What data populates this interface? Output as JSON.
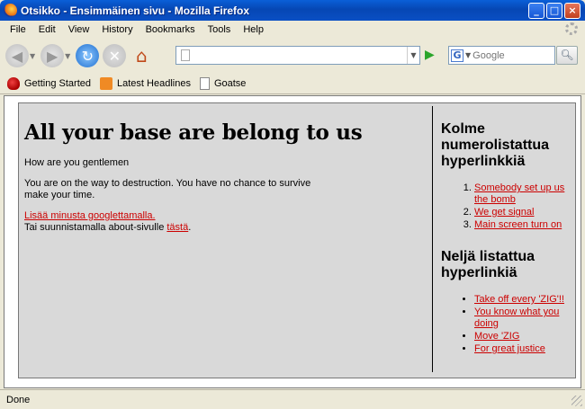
{
  "window": {
    "title": "Otsikko - Ensimmäinen sivu - Mozilla Firefox",
    "minimize_label": "_",
    "maximize_label": "□",
    "close_label": "×"
  },
  "menubar": {
    "items": [
      {
        "label": "File"
      },
      {
        "label": "Edit"
      },
      {
        "label": "View"
      },
      {
        "label": "History"
      },
      {
        "label": "Bookmarks"
      },
      {
        "label": "Tools"
      },
      {
        "label": "Help"
      }
    ]
  },
  "navbar": {
    "url_value": "",
    "search_placeholder": "Google",
    "search_engine_letter": "G"
  },
  "bookmarks": {
    "items": [
      {
        "label": "Getting Started"
      },
      {
        "label": "Latest Headlines"
      },
      {
        "label": "Goatse"
      }
    ]
  },
  "page": {
    "heading": "All your base are belong to us",
    "para1": "How are you gentlemen",
    "para2": "You are on the way to destruction. You have no chance to survive make your time.",
    "link1": "Lisää minusta googlettamalla.",
    "para3_prefix": "Tai suunnistamalla about-sivulle ",
    "link2": "tästä",
    "para3_suffix": ".",
    "side": {
      "heading1": "Kolme numerolistattua hyperlinkkiä",
      "ordered": [
        "Somebody set up us the bomb",
        "We get signal",
        "Main screen turn on"
      ],
      "heading2": "Neljä listattua hyperlinkiä",
      "unordered": [
        "Take off every 'ZIG'!!",
        "You know what you doing",
        "Move 'ZIG",
        "For great justice"
      ]
    }
  },
  "status": {
    "text": "Done"
  },
  "colors": {
    "link": "#cc0000",
    "page_background": "#d9d9d9",
    "chrome": "#ece9d8",
    "titlebar": "#0647b4"
  }
}
